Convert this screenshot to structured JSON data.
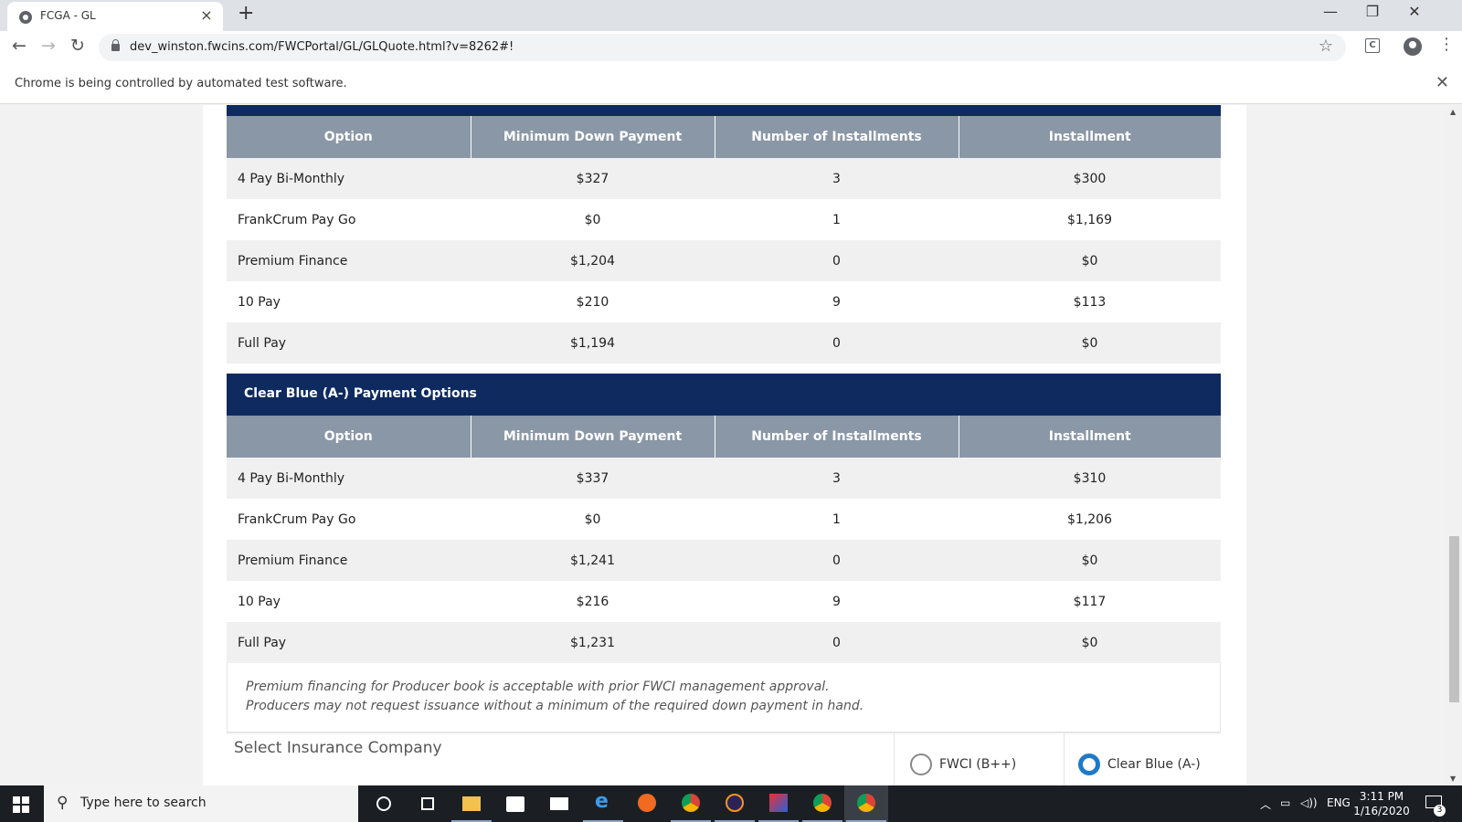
{
  "browser": {
    "tab_title": "FCGA - GL",
    "tab_close": "×",
    "new_tab": "+",
    "url": "dev_winston.fwcins.com/FWCPortal/GL/GLQuote.html?v=8262#!",
    "infobar_message": "Chrome is being controlled by automated test software.",
    "window_controls": {
      "minimize": "—",
      "restore": "❐",
      "close": "✕"
    },
    "nav": {
      "back": "←",
      "forward": "→",
      "reload": "↻"
    },
    "star": "☆",
    "menu": "⋮",
    "ext_label": "C",
    "infobar_close": "✕"
  },
  "table_headers": [
    "Option",
    "Minimum Down Payment",
    "Number of Installments",
    "Installment"
  ],
  "fwci_table": {
    "rows": [
      [
        "4 Pay Bi-Monthly",
        "$327",
        "3",
        "$300"
      ],
      [
        "FrankCrum Pay Go",
        "$0",
        "1",
        "$1,169"
      ],
      [
        "Premium Finance",
        "$1,204",
        "0",
        "$0"
      ],
      [
        "10 Pay",
        "$210",
        "9",
        "$113"
      ],
      [
        "Full Pay",
        "$1,194",
        "0",
        "$0"
      ]
    ]
  },
  "clearblue_table": {
    "title": "Clear Blue (A-) Payment Options",
    "rows": [
      [
        "4 Pay Bi-Monthly",
        "$337",
        "3",
        "$310"
      ],
      [
        "FrankCrum Pay Go",
        "$0",
        "1",
        "$1,206"
      ],
      [
        "Premium Finance",
        "$1,241",
        "0",
        "$0"
      ],
      [
        "10 Pay",
        "$216",
        "9",
        "$117"
      ],
      [
        "Full Pay",
        "$1,231",
        "0",
        "$0"
      ]
    ]
  },
  "note": {
    "line1": "Premium financing for Producer book is acceptable with prior FWCI management approval.",
    "line2": "Producers may not request issuance without a minimum of the required down payment in hand."
  },
  "select_company": {
    "label": "Select Insurance Company",
    "options": [
      {
        "label": "FWCI (B++)",
        "checked": false
      },
      {
        "label": "Clear Blue (A-)",
        "checked": true
      }
    ]
  },
  "taskbar": {
    "search_placeholder": "Type here to search",
    "language": "ENG",
    "time": "3:11 PM",
    "date": "1/16/2020",
    "notification_count": "3"
  },
  "colors": {
    "section_header": "#0e2a5f",
    "table_header": "#8a97a6",
    "radio_checked": "#1e7ac7"
  }
}
